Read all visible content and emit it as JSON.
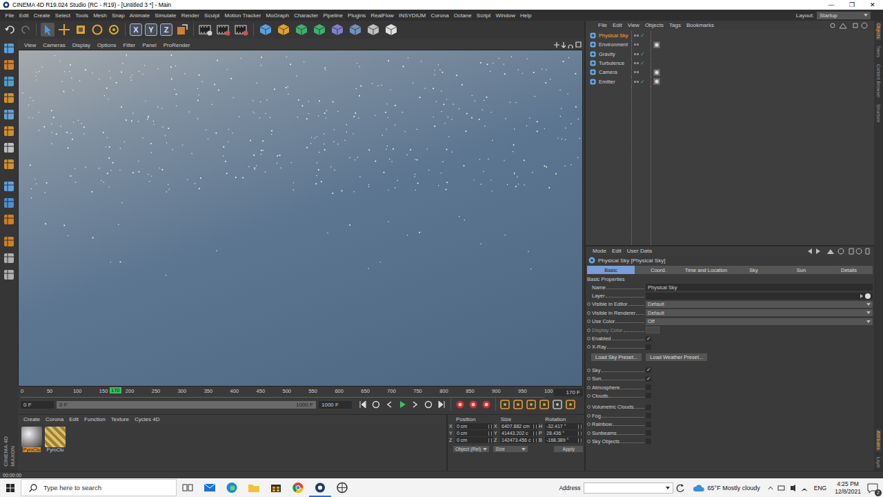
{
  "window": {
    "title": "CINEMA 4D R19.024 Studio (RC - R19) - [Untitled 3 *] - Main",
    "controls": [
      "—",
      "❐",
      "✕"
    ]
  },
  "menu": [
    "File",
    "Edit",
    "Create",
    "Select",
    "Tools",
    "Mesh",
    "Snap",
    "Animate",
    "Simulate",
    "Render",
    "Sculpt",
    "Motion Tracker",
    "MoGraph",
    "Character",
    "Pipeline",
    "Plugins",
    "RealFlow",
    "INSYDIUM",
    "Corona",
    "Octane",
    "Script",
    "Window",
    "Help"
  ],
  "layout": {
    "label": "Layout:",
    "value": "Startup"
  },
  "toolbar": {
    "axis_locks": [
      "X",
      "Y",
      "Z"
    ]
  },
  "viewport": {
    "menu": [
      "View",
      "Cameras",
      "Display",
      "Options",
      "Filter",
      "Panel",
      "ProRender"
    ]
  },
  "timeline": {
    "ticks": [
      "0",
      "50",
      "100",
      "150",
      "200",
      "250",
      "300",
      "350",
      "400",
      "450",
      "500",
      "550",
      "600",
      "650",
      "700",
      "750",
      "800",
      "850",
      "900",
      "950",
      "100"
    ],
    "current": "170",
    "level": 0.17,
    "frame_field": "170 F"
  },
  "playback": {
    "start": "0 F",
    "range_start": "0 F",
    "range_end": "1000 F",
    "end": "1000 F"
  },
  "materials": {
    "menu": [
      "Create",
      "Corona",
      "Edit",
      "Function",
      "Texture",
      "Cycles 4D"
    ],
    "items": [
      {
        "name": "PyroClu",
        "selected": true
      },
      {
        "name": "PyroClu",
        "selected": false
      }
    ]
  },
  "coords": {
    "headers": [
      "Position",
      "Size",
      "Rotation"
    ],
    "rows": [
      {
        "p_axis": "X",
        "position": "0 cm",
        "s_axis": "X",
        "size": "6407.882 cm",
        "r_axis": "H",
        "rotation": "-32.417 °"
      },
      {
        "p_axis": "Y",
        "position": "0 cm",
        "s_axis": "Y",
        "size": "41443.202 c",
        "r_axis": "P",
        "rotation": "28.436 °"
      },
      {
        "p_axis": "Z",
        "position": "0 cm",
        "s_axis": "Z",
        "size": "142473.456 c",
        "r_axis": "B",
        "rotation": "-168.389 °"
      }
    ],
    "mode": "Object (Rel)",
    "size_mode": "Size",
    "apply": "Apply"
  },
  "logo": [
    "MAXON",
    "CINEMA 4D"
  ],
  "status_bar": "00:00:00",
  "objects": {
    "menu": [
      "File",
      "Edit",
      "View",
      "Objects",
      "Tags",
      "Bookmarks"
    ],
    "check": "✓",
    "items": [
      {
        "name": "Physical Sky",
        "selected": true,
        "checked": true,
        "tag": false
      },
      {
        "name": "Environment",
        "selected": false,
        "checked": false,
        "tag": true
      },
      {
        "name": "Gravity",
        "selected": false,
        "checked": true,
        "tag": false
      },
      {
        "name": "Turbulence",
        "selected": false,
        "checked": true,
        "tag": false
      },
      {
        "name": "Camera",
        "selected": false,
        "checked": false,
        "tag": true
      },
      {
        "name": "Emitter",
        "selected": false,
        "checked": true,
        "tag": true
      }
    ]
  },
  "side_tabs_top": [
    {
      "label": "Objects",
      "selected": true
    },
    {
      "label": "Takes",
      "selected": false
    },
    {
      "label": "Content Browser",
      "selected": false
    },
    {
      "label": "Structure",
      "selected": false
    }
  ],
  "side_tabs_bottom": [
    {
      "label": "Attributes",
      "selected": true
    },
    {
      "label": "Layer",
      "selected": false
    }
  ],
  "attributes": {
    "menu": [
      "Mode",
      "Edit",
      "User Data"
    ],
    "title": "Physical Sky [Physical Sky]",
    "check": "✓",
    "tabs": [
      {
        "label": "Basic",
        "selected": true
      },
      {
        "label": "Coord.",
        "selected": false
      },
      {
        "label": "Time and Location",
        "selected": false
      },
      {
        "label": "Sky",
        "selected": false
      },
      {
        "label": "Sun",
        "selected": false
      },
      {
        "label": "Details",
        "selected": false
      }
    ],
    "section": "Basic Properties",
    "fields": [
      {
        "label": "Name",
        "kind": "text",
        "value": "Physical Sky",
        "disabled": false,
        "animatable": false
      },
      {
        "label": "Layer",
        "kind": "layer",
        "value": "",
        "disabled": false,
        "animatable": false
      },
      {
        "label": "Visible in Editor",
        "kind": "select",
        "value": "Default",
        "disabled": false,
        "animatable": true
      },
      {
        "label": "Visible in Renderer",
        "kind": "select",
        "value": "Default",
        "disabled": false,
        "animatable": true
      },
      {
        "label": "Use Color",
        "kind": "select",
        "value": "Off",
        "disabled": false,
        "animatable": true
      },
      {
        "label": "Display Color",
        "kind": "color",
        "value": "",
        "disabled": true,
        "animatable": true
      },
      {
        "label": "Enabled",
        "kind": "check",
        "value": "",
        "checked": true,
        "disabled": false,
        "animatable": true
      },
      {
        "label": "X-Ray",
        "kind": "check",
        "value": "",
        "checked": false,
        "disabled": false,
        "animatable": true
      }
    ],
    "buttons": [
      "Load Sky Preset...",
      "Load Weather Preset..."
    ],
    "groups": [
      [
        {
          "label": "Sky",
          "checked": true
        },
        {
          "label": "Sun",
          "checked": true
        },
        {
          "label": "Atmosphere",
          "checked": false
        },
        {
          "label": "Clouds",
          "checked": false
        }
      ],
      [
        {
          "label": "Volumetric Clouds",
          "checked": false
        },
        {
          "label": "Fog",
          "checked": false
        },
        {
          "label": "Rainbow",
          "checked": false
        },
        {
          "label": "Sunbeams",
          "checked": false
        },
        {
          "label": "Sky Objects",
          "checked": false
        }
      ]
    ]
  },
  "taskbar": {
    "search": "Type here to search",
    "address": "Address",
    "weather": "65°F Mostly cloudy",
    "lang": "ENG",
    "time": "4:25 PM",
    "date": "12/8/2021",
    "notifications": "2"
  }
}
